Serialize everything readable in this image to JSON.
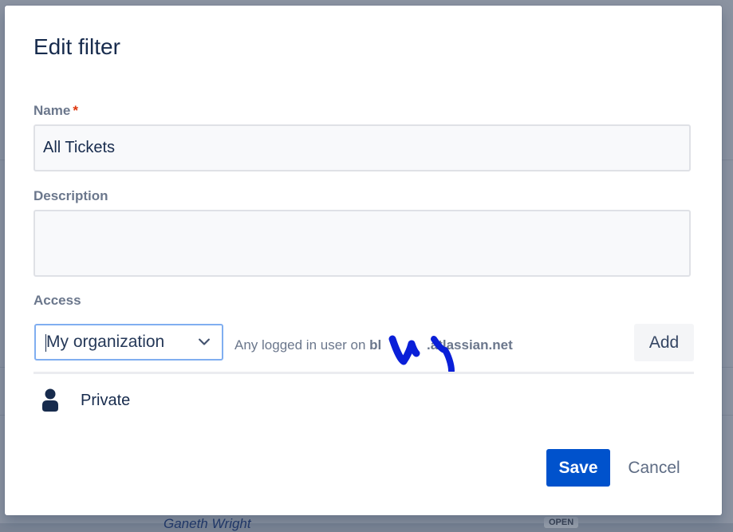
{
  "dialog": {
    "title": "Edit filter",
    "name": {
      "label": "Name",
      "required_marker": "*",
      "value": "All Tickets"
    },
    "description": {
      "label": "Description",
      "value": ""
    },
    "access": {
      "label": "Access",
      "selected_option": "My organization",
      "description_prefix": "Any logged in user on ",
      "site_suffix": "atlassian.net",
      "add_label": "Add"
    },
    "shares": [
      {
        "icon": "person-icon",
        "label": "Private"
      }
    ],
    "actions": {
      "save_label": "Save",
      "cancel_label": "Cancel"
    }
  },
  "background": {
    "link_fragment": "Ganeth Wright",
    "status_fragment": "OPEN"
  },
  "colors": {
    "primary_button": "#0052cc",
    "title_text": "#172b4d",
    "label_text": "#6b778c",
    "required": "#de350b",
    "select_focus_border": "#80aef0",
    "redaction_scribble": "#0a1fd8"
  }
}
